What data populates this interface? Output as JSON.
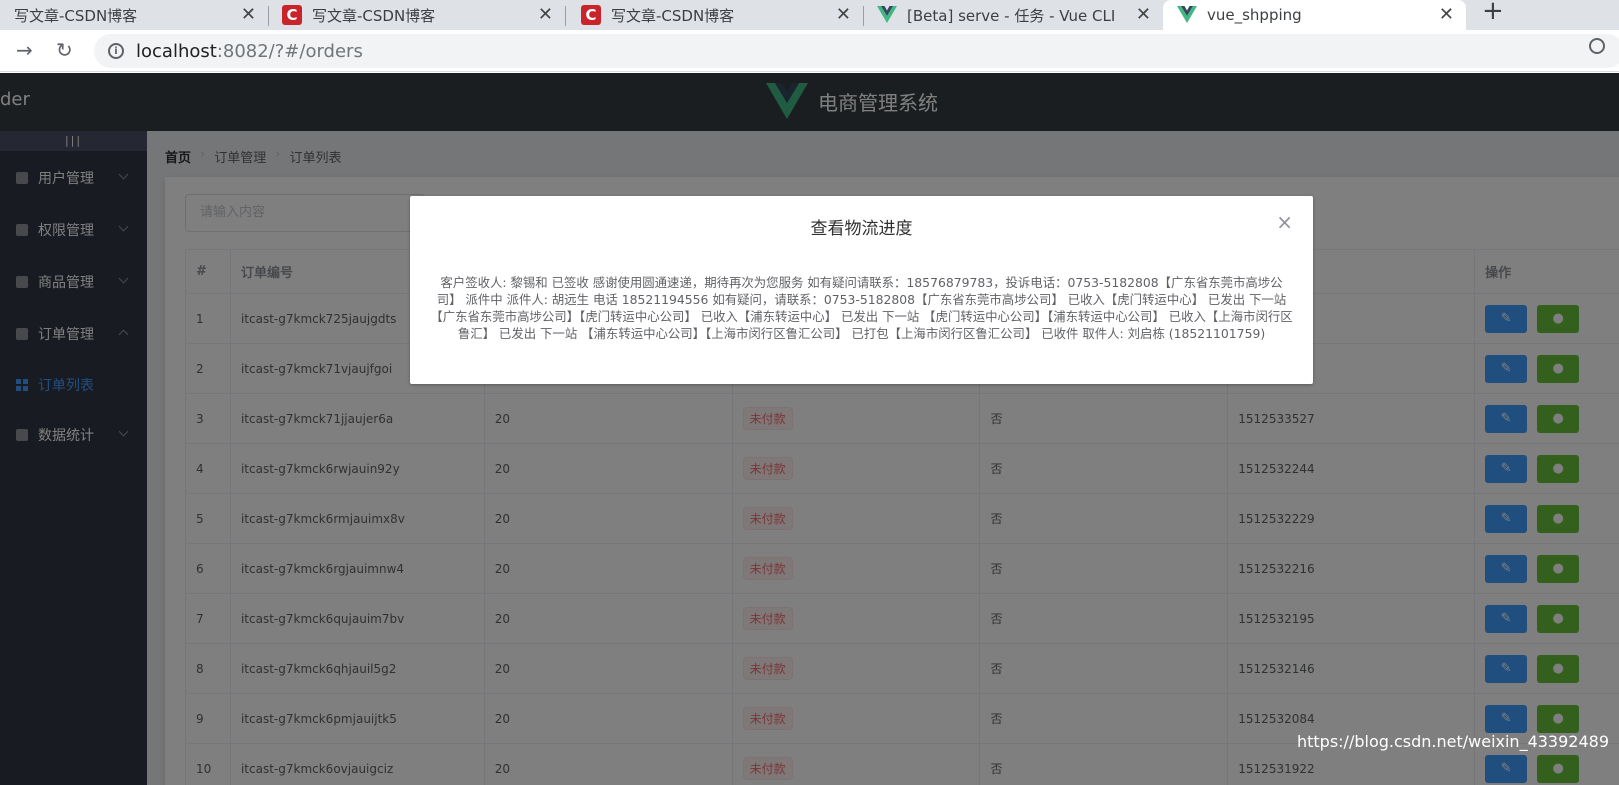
{
  "browser": {
    "tabs": [
      {
        "title": "写文章-CSDN博客",
        "icon": "csdn-icon"
      },
      {
        "title": "写文章-CSDN博客",
        "icon": "csdn-icon"
      },
      {
        "title": "写文章-CSDN博客",
        "icon": "csdn-icon"
      },
      {
        "title": "[Beta] serve - 任务 - Vue CLI",
        "icon": "vue-icon"
      },
      {
        "title": "vue_shpping",
        "icon": "vue-icon"
      }
    ],
    "url_host": "localhost",
    "url_rest": ":8082/?#/orders",
    "close_glyph": "✕",
    "newtab_glyph": "+"
  },
  "header": {
    "left_fragment": "der",
    "title": "电商管理系统"
  },
  "sidebar": {
    "toggle": "|||",
    "items": [
      {
        "label": "用户管理"
      },
      {
        "label": "权限管理"
      },
      {
        "label": "商品管理"
      },
      {
        "label": "订单管理"
      },
      {
        "label": "数据统计"
      }
    ],
    "sub_item": "订单列表"
  },
  "breadcrumb": {
    "home": "首页",
    "level1": "订单管理",
    "level2": "订单列表",
    "sep": "›"
  },
  "search": {
    "placeholder": "请输入内容"
  },
  "table": {
    "headers": [
      "#",
      "订单编号",
      "",
      "",
      "",
      "",
      "操作"
    ],
    "rows": [
      {
        "n": "1",
        "id": "itcast-g7kmck725jaujgdts",
        "price": "",
        "status": "",
        "send": "",
        "time": ""
      },
      {
        "n": "2",
        "id": "itcast-g7kmck71vjaujfgoi",
        "price": "",
        "status": "",
        "send": "",
        "time": ""
      },
      {
        "n": "3",
        "id": "itcast-g7kmck71jjaujer6a",
        "price": "20",
        "status": "未付款",
        "send": "否",
        "time": "1512533527"
      },
      {
        "n": "4",
        "id": "itcast-g7kmck6rwjauin92y",
        "price": "20",
        "status": "未付款",
        "send": "否",
        "time": "1512532244"
      },
      {
        "n": "5",
        "id": "itcast-g7kmck6rmjauimx8v",
        "price": "20",
        "status": "未付款",
        "send": "否",
        "time": "1512532229"
      },
      {
        "n": "6",
        "id": "itcast-g7kmck6rgjauimnw4",
        "price": "20",
        "status": "未付款",
        "send": "否",
        "time": "1512532216"
      },
      {
        "n": "7",
        "id": "itcast-g7kmck6qujauim7bv",
        "price": "20",
        "status": "未付款",
        "send": "否",
        "time": "1512532195"
      },
      {
        "n": "8",
        "id": "itcast-g7kmck6qhjauil5g2",
        "price": "20",
        "status": "未付款",
        "send": "否",
        "time": "1512532146"
      },
      {
        "n": "9",
        "id": "itcast-g7kmck6pmjauijtk5",
        "price": "20",
        "status": "未付款",
        "send": "否",
        "time": "1512532084"
      },
      {
        "n": "10",
        "id": "itcast-g7kmck6ovjauigciz",
        "price": "20",
        "status": "未付款",
        "send": "否",
        "time": "1512531922"
      }
    ]
  },
  "dialog": {
    "title": "查看物流进度",
    "close": "×",
    "body": "客户签收人: 黎锡和 已签收 感谢使用圆通速递，期待再次为您服务 如有疑问请联系：18576879783，投诉电话：0753-5182808【广东省东莞市高埗公司】 派件中 派件人: 胡远生 电话 18521194556 如有疑问，请联系：0753-5182808【广东省东莞市高埗公司】 已收入【虎门转运中心】 已发出 下一站 【广东省东莞市高埗公司】【虎门转运中心公司】 已收入【浦东转运中心】 已发出 下一站 【虎门转运中心公司】【浦东转运中心公司】 已收入【上海市闵行区鲁汇】 已发出 下一站 【浦东转运中心公司】【上海市闵行区鲁汇公司】 已打包【上海市闵行区鲁汇公司】 已收件 取件人: 刘启栋 (18521101759)"
  },
  "watermark": "https://blog.csdn.net/weixin_43392489",
  "colors": {
    "primary": "#409eff",
    "success": "#67c23a",
    "danger": "#f56c6c",
    "sidebar": "#333744",
    "header": "#373d41"
  }
}
